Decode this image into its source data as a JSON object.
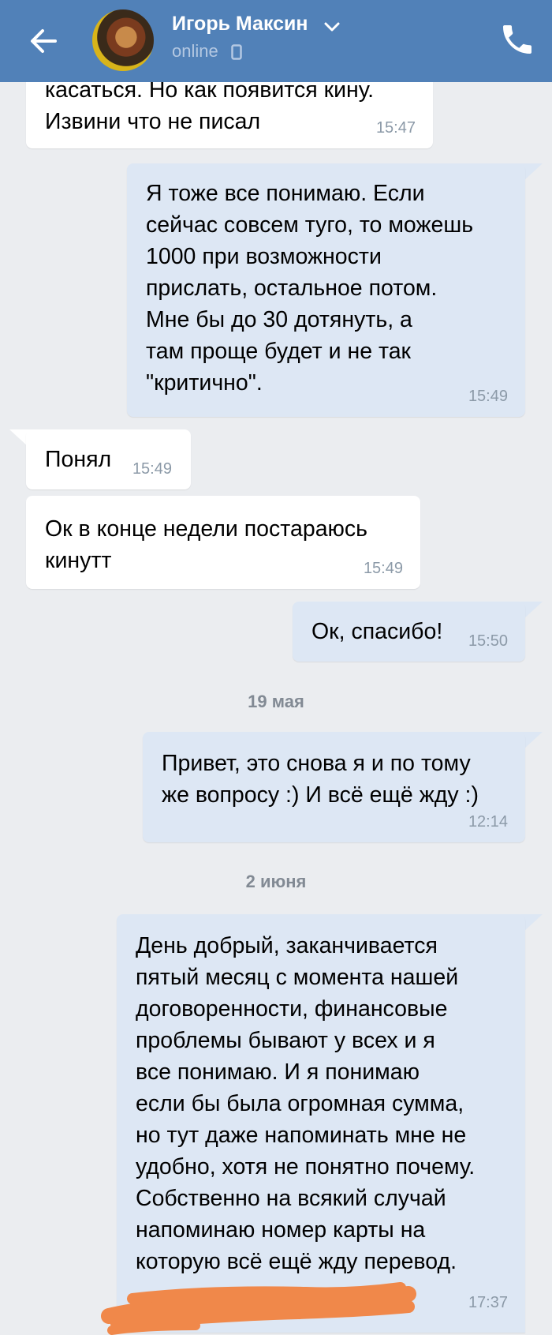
{
  "header": {
    "contact_name": "Игорь Максин",
    "status": "online",
    "accent_color": "#5181b8"
  },
  "messages": [
    {
      "direction": "in",
      "text": "касаться. Но как появится кину.\nИзвини что не писал",
      "time": "15:47"
    },
    {
      "direction": "out",
      "text": "Я тоже все понимаю. Если\nсейчас совсем туго, то можешь\n1000 при возможности\nприслать, остальное потом.\nМне бы до 30 дотянуть, а\nтам проще будет и не так\n\"критично\".",
      "time": "15:49"
    },
    {
      "direction": "in",
      "text": "Понял",
      "time": "15:49"
    },
    {
      "direction": "in",
      "text": "Ок в конце недели постараюсь\nкинутт",
      "time": "15:49"
    },
    {
      "direction": "out",
      "text": "Ок, спасибо!",
      "time": "15:50"
    },
    {
      "direction": "out",
      "text": "Привет, это снова я и по тому\nже вопросу :) И всё ещё жду :)",
      "time": "12:14"
    },
    {
      "direction": "out",
      "text": "День добрый, заканчивается\nпятый месяц с момента нашей\nдоговоренности, финансовые\nпроблемы бывают у всех и я\nвсе понимаю. И я понимаю\nесли бы была огромная сумма,\nно тут даже напоминать мне не\nудобно, хотя не понятно почему.\nСобственно на всякий случай\nнапоминаю номер карты на\nкоторую всё ещё жду перевод.",
      "time": "17:37"
    }
  ],
  "date_separators": [
    "19 мая",
    "2 июня"
  ],
  "colors": {
    "incoming_bubble": "#ffffff",
    "outgoing_bubble": "#dde7f4",
    "background": "#ebedf0",
    "redaction": "#f0884a"
  }
}
